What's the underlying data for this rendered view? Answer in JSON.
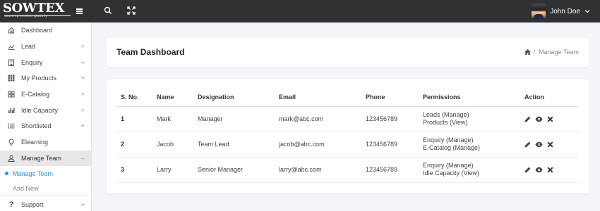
{
  "brand": {
    "name": "SOWTEX",
    "tagline": "sourcing textiles globally"
  },
  "topbar": {
    "icons": [
      "hamburger-icon",
      "search-icon",
      "fullscreen-icon"
    ],
    "user": {
      "name": "John Doe"
    }
  },
  "sidebar": {
    "items": [
      {
        "label": "Dashboard",
        "icon": "home-icon",
        "expandable": false
      },
      {
        "label": "Lead",
        "icon": "chart-icon",
        "expandable": true
      },
      {
        "label": "Enquiry",
        "icon": "building-icon",
        "expandable": true
      },
      {
        "label": "My Products",
        "icon": "grid-icon",
        "expandable": true
      },
      {
        "label": "E-Catalog",
        "icon": "catalog-icon",
        "expandable": true
      },
      {
        "label": "Idle Capacity",
        "icon": "bars-icon",
        "expandable": true
      },
      {
        "label": "Shortlisted",
        "icon": "list-icon",
        "expandable": true
      },
      {
        "label": "Elearning",
        "icon": "bulb-icon",
        "expandable": false
      },
      {
        "label": "Manage Team",
        "icon": "user-icon",
        "expandable": true,
        "expanded": true
      }
    ],
    "subitems": [
      {
        "label": "Manage Team",
        "current": true
      },
      {
        "label": "Add New",
        "current": false
      }
    ],
    "after": {
      "label": "Support",
      "icon": "question-icon"
    },
    "plus_symbol": "+",
    "minus_symbol": "–"
  },
  "page": {
    "title": "Team Dashboard",
    "breadcrumb": {
      "separator": "/",
      "current": "Manage Team"
    }
  },
  "table": {
    "headers": [
      "S. No.",
      "Name",
      "Designation",
      "Email",
      "Phone",
      "Permissions",
      "Action"
    ],
    "rows": [
      {
        "sno": "1",
        "name": "Mark",
        "designation": "Manager",
        "email": "mark@abc.com",
        "phone": "123456789",
        "permissions": [
          "Leads (Manage)",
          "Products (View)"
        ]
      },
      {
        "sno": "2",
        "name": "Jacob",
        "designation": "Team Lead",
        "email": "jacob@abc.com",
        "phone": "123456789",
        "permissions": [
          "Enquiry (Manage)",
          "E-Catalog (Manage)"
        ]
      },
      {
        "sno": "3",
        "name": "Larry",
        "designation": "Senior Manager",
        "email": "larry@abc.com",
        "phone": "123456789",
        "permissions": [
          "Enquiry (Manage)",
          "Idle Capacity (View)"
        ]
      }
    ],
    "action_icons": [
      "edit-icon",
      "view-icon",
      "delete-icon"
    ]
  },
  "colors": {
    "topbar": "#2f3133",
    "accent": "#2f8fd6",
    "background": "#f4f5f8"
  }
}
